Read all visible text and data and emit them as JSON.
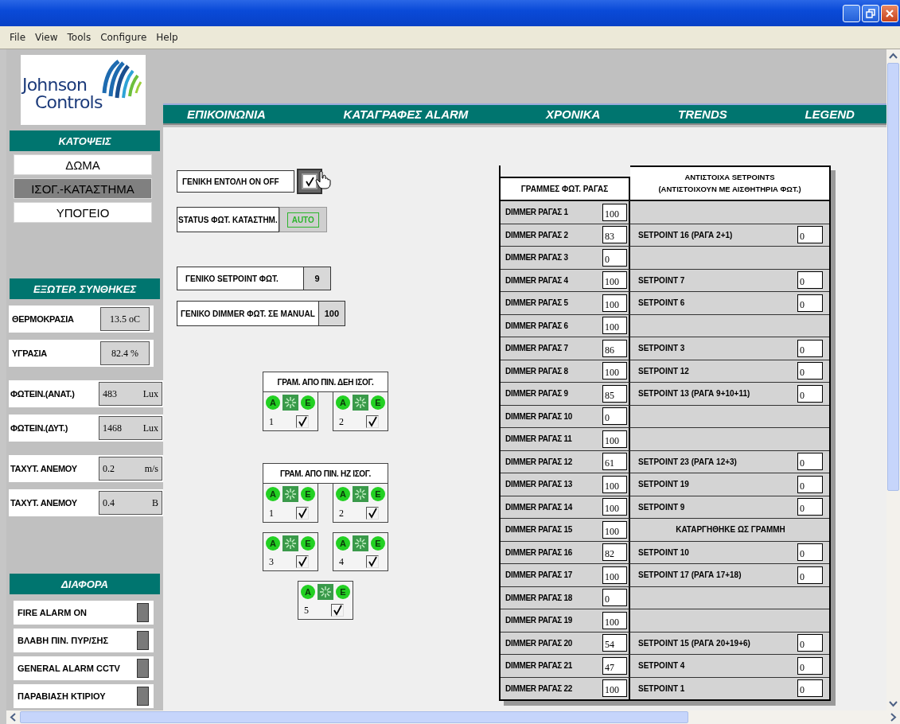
{
  "menu": [
    "File",
    "View",
    "Tools",
    "Configure",
    "Help"
  ],
  "logo": {
    "lines": [
      "Johnson",
      "Controls"
    ]
  },
  "nav": [
    {
      "label": "ΕΠΙΚΟΙΝΩΝΙΑ"
    },
    {
      "label": "ΚΑΤΑΓΡΑΦΕΣ ALARM"
    },
    {
      "label": "ΧΡΟΝΙΚΑ"
    },
    {
      "label": "TRENDS"
    },
    {
      "label": "LEGEND"
    }
  ],
  "floor_plans": {
    "title": "ΚΑΤΟΨΕΙΣ",
    "items": [
      {
        "label": "ΔΩΜΑ",
        "selected": false
      },
      {
        "label": "ΙΣΟΓ.-ΚΑΤΑΣΤΗΜΑ",
        "selected": true
      },
      {
        "label": "ΥΠΟΓΕΙΟ",
        "selected": false
      }
    ]
  },
  "external_conditions": {
    "title": "ΕΞΩΤΕΡ. ΣΥΝΘΗΚΕΣ",
    "readings": [
      {
        "label": "ΘΕΡΜΟΚΡΑΣΙΑ",
        "value": "13.5 oC"
      },
      {
        "label": "ΥΓΡΑΣΙΑ",
        "value": "82.4 %"
      },
      {
        "label": "ΦΩΤΕΙΝ.(ΑΝΑΤ.)",
        "value": "483",
        "unit": "Lux"
      },
      {
        "label": "ΦΩΤΕΙΝ.(ΔΥΤ.)",
        "value": "1468",
        "unit": "Lux"
      },
      {
        "label": "ΤΑΧΥΤ. ΑΝΕΜΟΥ",
        "value": "0.2",
        "unit": "m/s"
      },
      {
        "label": "ΤΑΧΥΤ. ΑΝΕΜΟΥ",
        "value": "0.4",
        "unit": "B"
      }
    ]
  },
  "misc": {
    "title": "ΔΙΑΦΟΡΑ",
    "alarms": [
      {
        "label": "FIRE ALARM ON",
        "on": false
      },
      {
        "label": "ΒΛΑΒΗ ΠΙΝ. ΠΥΡ/ΣΗΣ",
        "on": false
      },
      {
        "label": "GENERAL ALARM CCTV",
        "on": false
      },
      {
        "label": "ΠΑΡΑΒΙΑΣΗ ΚΤΙΡΙΟΥ",
        "on": false
      }
    ]
  },
  "general_command": {
    "label": "ΓΕΝΙΚΗ ΕΝΤΟΛΗ ON OFF",
    "checked": true
  },
  "status": {
    "label": "STATUS ΦΩΤ. ΚΑΤΑΣΤΗΜ.",
    "value": "AUTO"
  },
  "general_setpoint": {
    "label": "ΓΕΝΙΚΟ SETPOINT ΦΩΤ.",
    "value": "9"
  },
  "manual_dimmer": {
    "label": "ΓΕΝΙΚΟ DIMMER ΦΩΤ. ΣΕ MANUAL",
    "value": "100"
  },
  "line_groups": [
    {
      "title": "ΓΡΑΜ. ΑΠΟ ΠΙΝ. ΔΕΗ ΙΣΟΓ.",
      "panels": [
        {
          "left_lamp": "A",
          "right_lamp": "E",
          "number": "1",
          "checked": true
        },
        {
          "left_lamp": "A",
          "right_lamp": "E",
          "number": "2",
          "checked": true
        }
      ]
    },
    {
      "title": "ΓΡΑΜ. ΑΠΟ ΠΙΝ. ΗΖ ΙΣΟΓ.",
      "panels": [
        {
          "left_lamp": "A",
          "right_lamp": "E",
          "number": "1",
          "checked": true
        },
        {
          "left_lamp": "A",
          "right_lamp": "E",
          "number": "2",
          "checked": true
        },
        {
          "left_lamp": "A",
          "right_lamp": "E",
          "number": "3",
          "checked": true
        },
        {
          "left_lamp": "A",
          "right_lamp": "E",
          "number": "4",
          "checked": true
        },
        {
          "left_lamp": "A",
          "right_lamp": "E",
          "number": "5",
          "checked": true
        }
      ]
    }
  ],
  "table": {
    "columns": [
      "ΓΡΑΜΜΕΣ ΦΩΤ. ΡΑΓΑΣ",
      "ΑΝΤΙΣΤΟΙΧΑ SETPOINTS",
      "(ΑΝΤΙΣΤΟΙΧΟΥΝ ΜΕ ΑΙΣΘΗΤΗΡΙΑ ΦΩΤ.)"
    ],
    "rows": [
      {
        "kind": "empty",
        "dimmer": "DIMMER ΡΑΓΑΣ 1",
        "value": "100"
      },
      {
        "kind": "setpoint",
        "dimmer": "DIMMER ΡΑΓΑΣ 2",
        "value": "83",
        "setpoint": "SETPOINT 16 (ΡΑΓΑ 2+1)",
        "setpoint_value": "0"
      },
      {
        "kind": "empty",
        "dimmer": "DIMMER ΡΑΓΑΣ 3",
        "value": "0"
      },
      {
        "kind": "setpoint",
        "dimmer": "DIMMER ΡΑΓΑΣ 4",
        "value": "100",
        "setpoint": "SETPOINT 7",
        "setpoint_value": "0"
      },
      {
        "kind": "setpoint",
        "dimmer": "DIMMER ΡΑΓΑΣ 5",
        "value": "100",
        "setpoint": "SETPOINT 6",
        "setpoint_value": "0"
      },
      {
        "kind": "empty",
        "dimmer": "DIMMER ΡΑΓΑΣ 6",
        "value": "100"
      },
      {
        "kind": "setpoint",
        "dimmer": "DIMMER ΡΑΓΑΣ 7",
        "value": "86",
        "setpoint": "SETPOINT 3",
        "setpoint_value": "0"
      },
      {
        "kind": "setpoint",
        "dimmer": "DIMMER ΡΑΓΑΣ 8",
        "value": "100",
        "setpoint": "SETPOINT 12",
        "setpoint_value": "0"
      },
      {
        "kind": "setpoint",
        "dimmer": "DIMMER ΡΑΓΑΣ 9",
        "value": "85",
        "setpoint": "SETPOINT 13 (ΡΑΓΑ 9+10+11)",
        "setpoint_value": "0"
      },
      {
        "kind": "empty",
        "dimmer": "DIMMER ΡΑΓΑΣ 10",
        "value": "0"
      },
      {
        "kind": "empty",
        "dimmer": "DIMMER ΡΑΓΑΣ 11",
        "value": "100"
      },
      {
        "kind": "setpoint",
        "dimmer": "DIMMER ΡΑΓΑΣ 12",
        "value": "61",
        "setpoint": "SETPOINT 23 (ΡΑΓΑ 12+3)",
        "setpoint_value": "0"
      },
      {
        "kind": "setpoint",
        "dimmer": "DIMMER ΡΑΓΑΣ 13",
        "value": "100",
        "setpoint": "SETPOINT 19",
        "setpoint_value": "0"
      },
      {
        "kind": "setpoint",
        "dimmer": "DIMMER ΡΑΓΑΣ 14",
        "value": "100",
        "setpoint": "SETPOINT 9",
        "setpoint_value": "0"
      },
      {
        "kind": "note",
        "dimmer": "DIMMER ΡΑΓΑΣ 15",
        "value": "100",
        "note": "ΚΑΤΑΡΓΗΘΗΚΕ ΩΣ ΓΡΑΜΜΗ"
      },
      {
        "kind": "setpoint",
        "dimmer": "DIMMER ΡΑΓΑΣ 16",
        "value": "82",
        "setpoint": "SETPOINT 10",
        "setpoint_value": "0"
      },
      {
        "kind": "setpoint",
        "dimmer": "DIMMER ΡΑΓΑΣ 17",
        "value": "100",
        "setpoint": "SETPOINT 17 (ΡΑΓΑ 17+18)",
        "setpoint_value": "0"
      },
      {
        "kind": "empty",
        "dimmer": "DIMMER ΡΑΓΑΣ 18",
        "value": "0"
      },
      {
        "kind": "empty",
        "dimmer": "DIMMER ΡΑΓΑΣ 19",
        "value": "100"
      },
      {
        "kind": "setpoint",
        "dimmer": "DIMMER ΡΑΓΑΣ 20",
        "value": "54",
        "setpoint": "SETPOINT 15 (ΡΑΓΑ 20+19+6)",
        "setpoint_value": "0"
      },
      {
        "kind": "setpoint",
        "dimmer": "DIMMER ΡΑΓΑΣ 21",
        "value": "47",
        "setpoint": "SETPOINT 4",
        "setpoint_value": "0"
      },
      {
        "kind": "setpoint",
        "dimmer": "DIMMER ΡΑΓΑΣ 22",
        "value": "100",
        "setpoint": "SETPOINT 1",
        "setpoint_value": "0"
      }
    ]
  }
}
